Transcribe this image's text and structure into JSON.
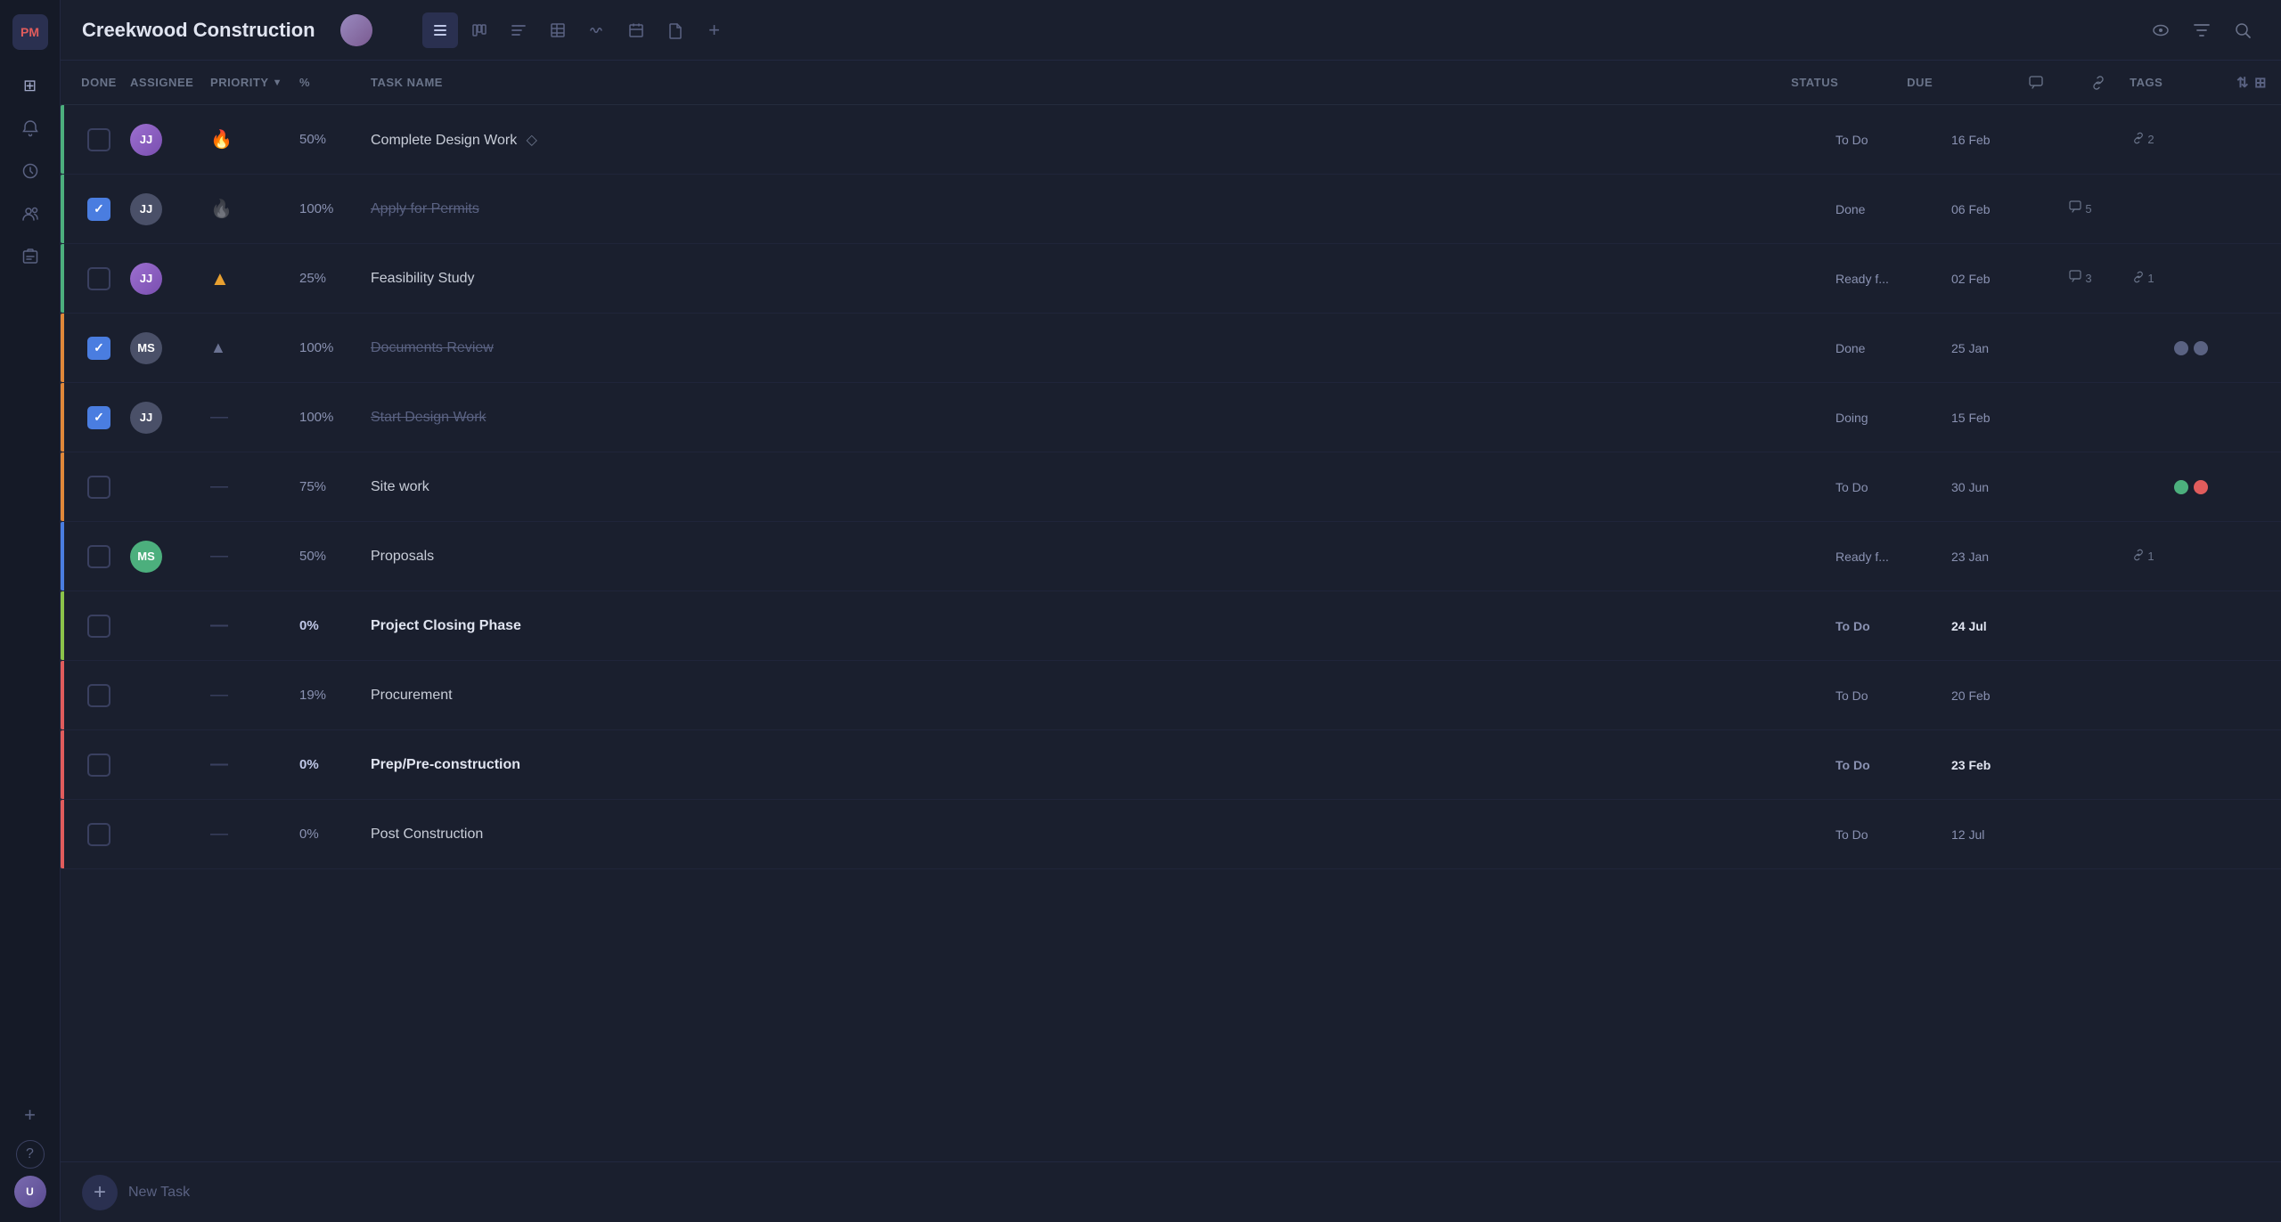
{
  "app": {
    "name": "Creekwood Construction",
    "logo_initials": "PM"
  },
  "sidebar": {
    "icons": [
      {
        "name": "home-icon",
        "symbol": "⊞",
        "active": false
      },
      {
        "name": "notifications-icon",
        "symbol": "🔔",
        "active": false
      },
      {
        "name": "clock-icon",
        "symbol": "⏱",
        "active": false
      },
      {
        "name": "users-icon",
        "symbol": "👥",
        "active": false
      },
      {
        "name": "briefcase-icon",
        "symbol": "💼",
        "active": false
      }
    ],
    "bottom_icons": [
      {
        "name": "add-icon",
        "symbol": "+"
      },
      {
        "name": "help-icon",
        "symbol": "?"
      }
    ]
  },
  "toolbar": {
    "icons": [
      {
        "name": "list-view-icon",
        "symbol": "☰",
        "active": true
      },
      {
        "name": "board-view-icon",
        "symbol": "⊞",
        "active": false
      },
      {
        "name": "gantt-view-icon",
        "symbol": "≡",
        "active": false
      },
      {
        "name": "table-view-icon",
        "symbol": "▦",
        "active": false
      },
      {
        "name": "timeline-view-icon",
        "symbol": "〜",
        "active": false
      },
      {
        "name": "calendar-view-icon",
        "symbol": "📅",
        "active": false
      },
      {
        "name": "doc-view-icon",
        "symbol": "📄",
        "active": false
      }
    ],
    "plus_label": "+"
  },
  "right_toolbar": {
    "icons": [
      {
        "name": "eye-icon",
        "symbol": "👁"
      },
      {
        "name": "filter-icon",
        "symbol": "⊿"
      },
      {
        "name": "search-icon",
        "symbol": "🔍"
      }
    ]
  },
  "columns": {
    "done": "DONE",
    "assignee": "ASSIGNEE",
    "priority": "PRIORITY",
    "pct": "%",
    "task_name": "TASK NAME",
    "status": "STATUS",
    "due": "DUE",
    "tags": "TAGS"
  },
  "tasks": [
    {
      "id": "t1",
      "done": false,
      "checked": false,
      "assignee": "JJ",
      "assignee_color": "av-purple",
      "priority": "fire",
      "priority_symbol": "🔥",
      "pct": "50%",
      "pct_bold": false,
      "task_name": "Complete Design Work",
      "has_diamond": true,
      "strikethrough": false,
      "bold": false,
      "status": "To Do",
      "due": "16 Feb",
      "due_bold": false,
      "comments": null,
      "links": 2,
      "tags": [],
      "accent": "accent-green"
    },
    {
      "id": "t2",
      "done": true,
      "checked": true,
      "assignee": "JJ",
      "assignee_color": "av-gray",
      "priority": "fire-gray",
      "priority_symbol": "🔥",
      "pct": "100%",
      "pct_bold": false,
      "task_name": "Apply for Permits",
      "has_diamond": false,
      "strikethrough": true,
      "bold": false,
      "status": "Done",
      "due": "06 Feb",
      "due_bold": false,
      "comments": 5,
      "links": null,
      "tags": [],
      "accent": "accent-green"
    },
    {
      "id": "t3",
      "done": false,
      "checked": false,
      "assignee": "JJ",
      "assignee_color": "av-purple",
      "priority": "up",
      "priority_symbol": "↑",
      "pct": "25%",
      "pct_bold": false,
      "task_name": "Feasibility Study",
      "has_diamond": false,
      "strikethrough": false,
      "bold": false,
      "status": "Ready f...",
      "due": "02 Feb",
      "due_bold": false,
      "comments": 3,
      "links": 1,
      "tags": [],
      "accent": "accent-green"
    },
    {
      "id": "t4",
      "done": true,
      "checked": true,
      "assignee": "MS",
      "assignee_color": "av-gray",
      "priority": "tri",
      "priority_symbol": "▲",
      "pct": "100%",
      "pct_bold": false,
      "task_name": "Documents Review",
      "has_diamond": false,
      "strikethrough": true,
      "bold": false,
      "status": "Done",
      "due": "25 Jan",
      "due_bold": false,
      "comments": null,
      "links": null,
      "tags": [
        "gray",
        "gray"
      ],
      "accent": "accent-orange"
    },
    {
      "id": "t5",
      "done": true,
      "checked": true,
      "assignee": "JJ",
      "assignee_color": "av-gray",
      "priority": "dash",
      "priority_symbol": "—",
      "pct": "100%",
      "pct_bold": false,
      "task_name": "Start Design Work",
      "has_diamond": false,
      "strikethrough": true,
      "bold": false,
      "status": "Doing",
      "due": "15 Feb",
      "due_bold": false,
      "comments": null,
      "links": null,
      "tags": [],
      "accent": "accent-orange"
    },
    {
      "id": "t6",
      "done": false,
      "checked": false,
      "assignee": null,
      "assignee_color": null,
      "priority": "dash",
      "priority_symbol": "—",
      "pct": "75%",
      "pct_bold": false,
      "task_name": "Site work",
      "has_diamond": false,
      "strikethrough": false,
      "bold": false,
      "status": "To Do",
      "due": "30 Jun",
      "due_bold": false,
      "comments": null,
      "links": null,
      "tags": [
        "green",
        "red"
      ],
      "accent": "accent-orange"
    },
    {
      "id": "t7",
      "done": false,
      "checked": false,
      "assignee": "MS",
      "assignee_color": "av-green",
      "priority": "dash",
      "priority_symbol": "—",
      "pct": "50%",
      "pct_bold": false,
      "task_name": "Proposals",
      "has_diamond": false,
      "strikethrough": false,
      "bold": false,
      "status": "Ready f...",
      "due": "23 Jan",
      "due_bold": false,
      "comments": null,
      "links": 1,
      "tags": [],
      "accent": "accent-blue"
    },
    {
      "id": "t8",
      "done": false,
      "checked": false,
      "assignee": null,
      "assignee_color": null,
      "priority": "dash",
      "priority_symbol": "—",
      "pct": "0%",
      "pct_bold": true,
      "task_name": "Project Closing Phase",
      "has_diamond": false,
      "strikethrough": false,
      "bold": true,
      "status": "To Do",
      "due": "24 Jul",
      "due_bold": true,
      "comments": null,
      "links": null,
      "tags": [],
      "accent": "accent-yellow-green"
    },
    {
      "id": "t9",
      "done": false,
      "checked": false,
      "assignee": null,
      "assignee_color": null,
      "priority": "dash",
      "priority_symbol": "—",
      "pct": "19%",
      "pct_bold": false,
      "task_name": "Procurement",
      "has_diamond": false,
      "strikethrough": false,
      "bold": false,
      "status": "To Do",
      "due": "20 Feb",
      "due_bold": false,
      "comments": null,
      "links": null,
      "tags": [],
      "accent": "accent-red"
    },
    {
      "id": "t10",
      "done": false,
      "checked": false,
      "assignee": null,
      "assignee_color": null,
      "priority": "dash",
      "priority_symbol": "—",
      "pct": "0%",
      "pct_bold": true,
      "task_name": "Prep/Pre-construction",
      "has_diamond": false,
      "strikethrough": false,
      "bold": true,
      "status": "To Do",
      "due": "23 Feb",
      "due_bold": true,
      "comments": null,
      "links": null,
      "tags": [],
      "accent": "accent-red"
    },
    {
      "id": "t11",
      "done": false,
      "checked": false,
      "assignee": null,
      "assignee_color": null,
      "priority": "dash",
      "priority_symbol": "—",
      "pct": "0%",
      "pct_bold": false,
      "task_name": "Post Construction",
      "has_diamond": false,
      "strikethrough": false,
      "bold": false,
      "status": "To Do",
      "due": "12 Jul",
      "due_bold": false,
      "comments": null,
      "links": null,
      "tags": [],
      "accent": "accent-red"
    }
  ],
  "bottom_bar": {
    "add_label": "+",
    "new_task_label": "New Task"
  }
}
